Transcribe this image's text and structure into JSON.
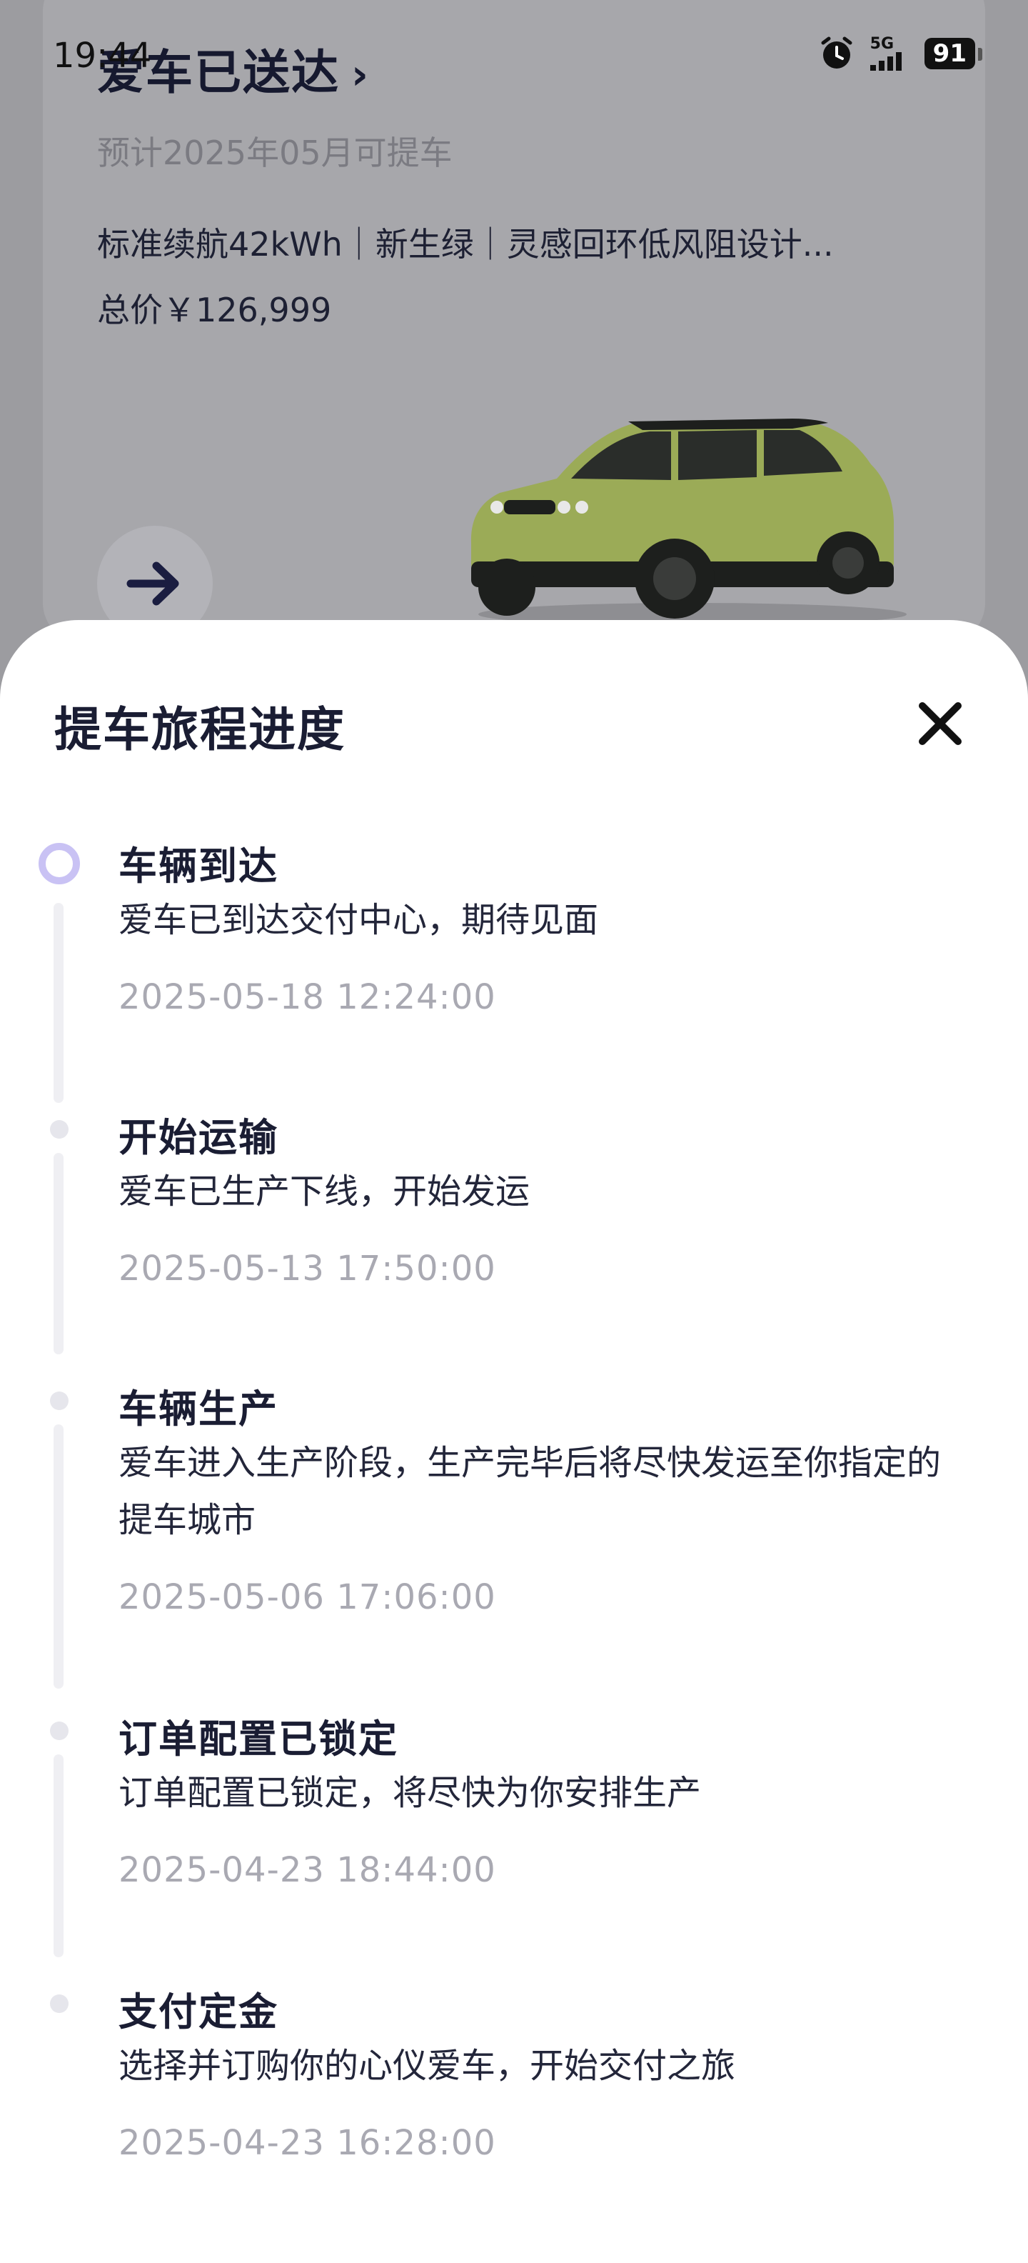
{
  "status_bar": {
    "time": "19:44",
    "network": "5G",
    "battery": "91"
  },
  "order_card": {
    "title": "爱车已送达",
    "subtitle": "预计2025年05月可提车",
    "config": "标准续航42kWh｜新生绿｜灵感回环低风阻设计...",
    "price": "总价￥126,999",
    "car_color": "#9bab57"
  },
  "sheet": {
    "title": "提车旅程进度",
    "steps": [
      {
        "title": "车辆到达",
        "desc": "爱车已到达交付中心，期待见面",
        "time": "2025-05-18 12:24:00",
        "active": true
      },
      {
        "title": "开始运输",
        "desc": "爱车已生产下线，开始发运",
        "time": "2025-05-13 17:50:00",
        "active": false
      },
      {
        "title": "车辆生产",
        "desc": "爱车进入生产阶段，生产完毕后将尽快发运至你指定的提车城市",
        "time": "2025-05-06 17:06:00",
        "active": false
      },
      {
        "title": "订单配置已锁定",
        "desc": "订单配置已锁定，将尽快为你安排生产",
        "time": "2025-04-23 18:44:00",
        "active": false
      },
      {
        "title": "支付定金",
        "desc": "选择并订购你的心仪爱车，开始交付之旅",
        "time": "2025-04-23 16:28:00",
        "active": false
      }
    ]
  },
  "colors": {
    "accent": "#c9c2f4",
    "text_primary": "#1a1d33",
    "text_muted": "#a9a9b2"
  }
}
